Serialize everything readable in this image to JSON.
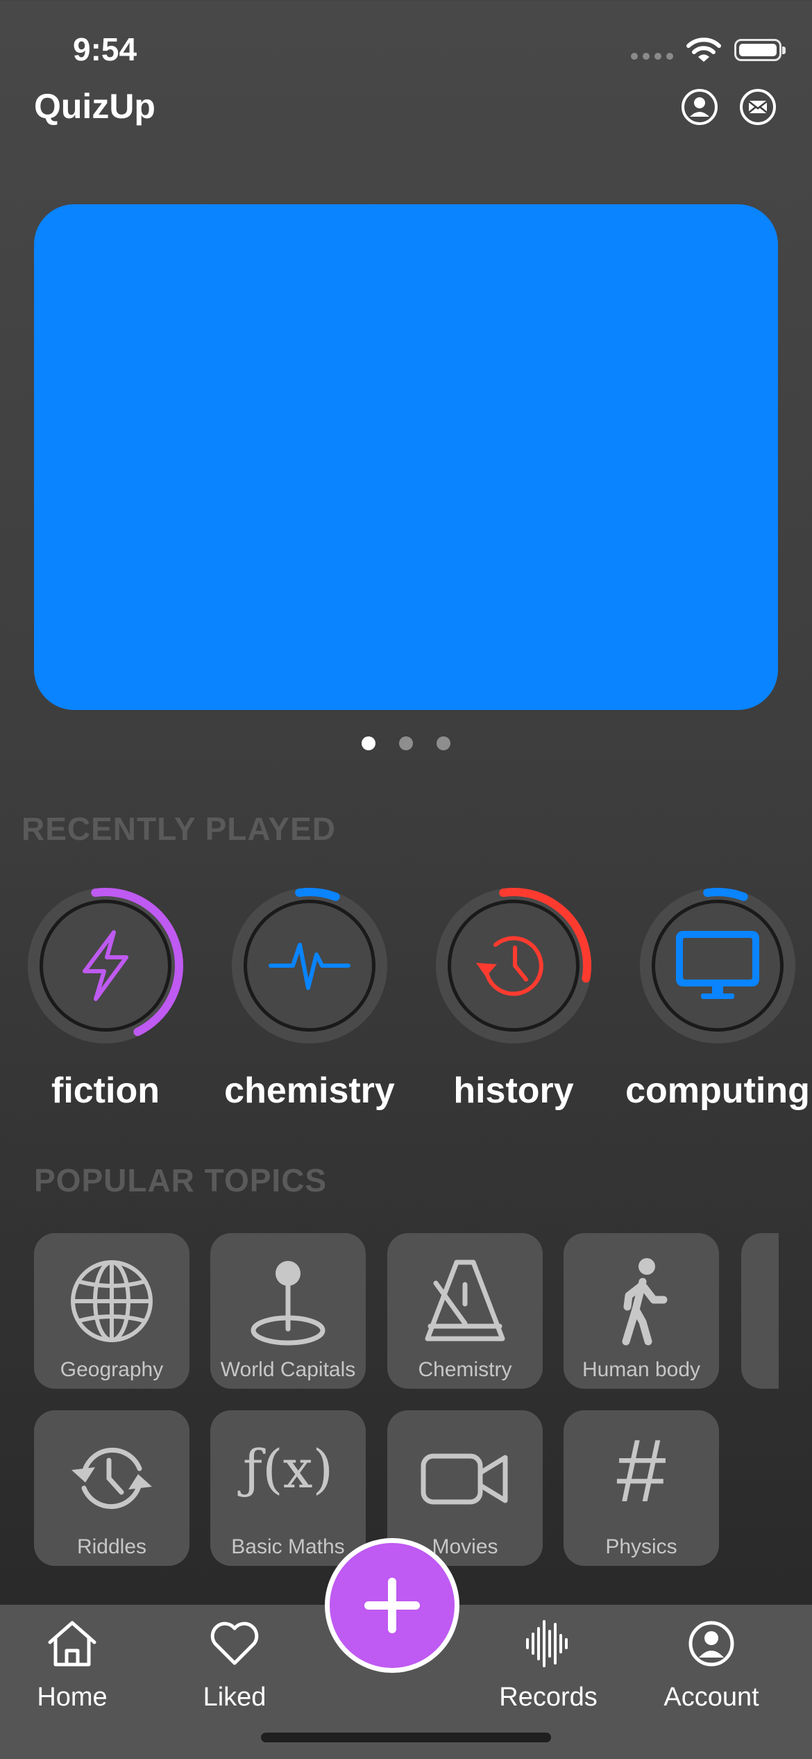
{
  "status_bar": {
    "time": "9:54"
  },
  "header": {
    "title": "QuizUp",
    "profile_icon": "person-circle-icon",
    "mail_icon": "envelope-circle-icon"
  },
  "banner": {
    "color": "#0a84ff",
    "page_count": 3,
    "active_page": 1
  },
  "recently_played": {
    "title": "RECENTLY PLAYED",
    "items": [
      {
        "label": "fiction",
        "icon": "bolt-icon",
        "color": "#bf5af2",
        "progress": 0.45
      },
      {
        "label": "chemistry",
        "icon": "waveform-path-icon",
        "color": "#0a84ff",
        "progress": 0.08
      },
      {
        "label": "history",
        "icon": "clock-history-icon",
        "color": "#ff3b30",
        "progress": 0.3
      },
      {
        "label": "computing",
        "icon": "desktop-computer-icon",
        "color": "#0a84ff",
        "progress": 0.08
      }
    ]
  },
  "popular_topics": {
    "title": "POPULAR TOPICS",
    "items": [
      {
        "label": "Geography",
        "icon": "globe-icon"
      },
      {
        "label": "World Capitals",
        "icon": "map-pin-icon"
      },
      {
        "label": "Chemistry",
        "icon": "metronome-icon"
      },
      {
        "label": "Human body",
        "icon": "walking-figure-icon"
      },
      {
        "label": "Riddles",
        "icon": "clock-arrows-icon"
      },
      {
        "label": "Basic Maths",
        "icon": "function-icon",
        "glyph": "ƒ(x)"
      },
      {
        "label": "Movies",
        "icon": "video-camera-icon"
      },
      {
        "label": "Physics",
        "icon": "number-sign-icon",
        "glyph": "#"
      }
    ]
  },
  "tab_bar": {
    "items": [
      {
        "label": "Home",
        "icon": "house-icon"
      },
      {
        "label": "Liked",
        "icon": "heart-icon"
      },
      {
        "label": "Records",
        "icon": "waveform-icon"
      },
      {
        "label": "Account",
        "icon": "person-circle-icon"
      }
    ],
    "fab_icon": "plus-icon",
    "fab_color": "#bf5af2"
  }
}
